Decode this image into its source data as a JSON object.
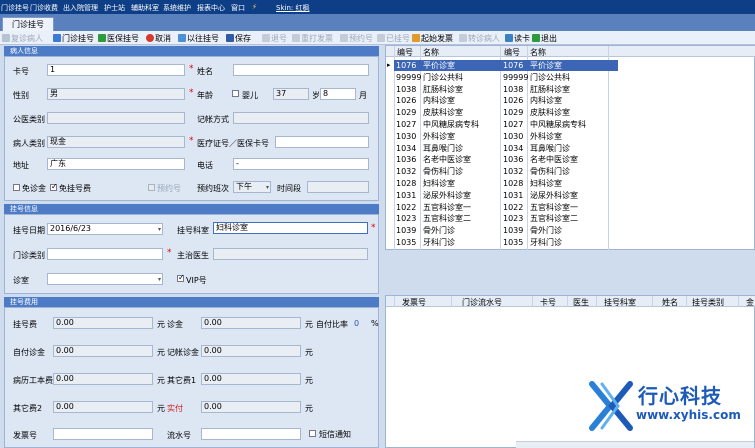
{
  "menu": [
    "门诊挂号",
    "门诊收费",
    "出入院管理",
    "护士站",
    "辅助科室",
    "系统维护",
    "报表中心",
    "窗口",
    "Skin: 红枫"
  ],
  "tab_label": "门诊挂号",
  "toolbar": {
    "items": [
      {
        "label": "复诊病人",
        "enabled": false
      },
      {
        "label": "门诊挂号",
        "enabled": true
      },
      {
        "label": "医保挂号",
        "enabled": true
      },
      {
        "label": "取消",
        "enabled": true
      },
      {
        "label": "以往挂号",
        "enabled": true
      },
      {
        "label": "保存",
        "enabled": true
      },
      {
        "label": "退号",
        "enabled": false
      },
      {
        "label": "重打发票",
        "enabled": false
      },
      {
        "label": "预约号",
        "enabled": false
      },
      {
        "label": "已挂号",
        "enabled": false
      },
      {
        "label": "起始发票",
        "enabled": true
      },
      {
        "label": "转诊病人",
        "enabled": false
      },
      {
        "label": "读卡",
        "enabled": true
      },
      {
        "label": "退出",
        "enabled": true
      }
    ]
  },
  "patient": {
    "section": "病人信息",
    "card_label": "卡号",
    "card_value": "1",
    "name_label": "姓名",
    "name_value": "",
    "gender_label": "性别",
    "gender_value": "男",
    "age_label": "年龄",
    "infant_label": "婴儿",
    "age_years": "37",
    "year_unit": "岁",
    "age_months": "8",
    "month_unit": "月",
    "insurance_label": "公医类别",
    "account_label": "记帐方式",
    "ptype_label": "病人类别",
    "ptype_value": "现金",
    "cert_label": "医疗证号／医保卡号",
    "addr_label": "地址",
    "addr_value": "广东",
    "phone_label": "电话",
    "phone_value": "-",
    "free_fee_label": "免诊金",
    "free_reg_label": "免挂号费",
    "reserve_label": "预约号",
    "reserve_time_label": "预约班次",
    "reserve_time_value": "下午",
    "time_label": "时间段"
  },
  "registration": {
    "section": "挂号信息",
    "date_label": "挂号日期",
    "date_value": "2016/6/23",
    "dept_label": "挂号科室",
    "dept_value": "妇科诊室",
    "clinic_type_label": "门诊类别",
    "doctor_label": "主治医生",
    "room_label": "诊室",
    "vip_label": "VIP号"
  },
  "fees": {
    "section": "挂号费用",
    "reg_fee_label": "挂号费",
    "reg_fee": "0.00",
    "consult_label": "诊金",
    "consult_fee": "0.00",
    "self_ratio_label": "自付比率",
    "self_ratio": "0",
    "pct": "%",
    "self_consult_label": "自付诊金",
    "self_consult": "0.00",
    "acct_consult_label": "记帐诊金",
    "acct_consult": "0.00",
    "record_label": "病历工本费",
    "record_fee": "0.00",
    "other1_label": "其它费1",
    "other1": "0.00",
    "other2_label": "其它费2",
    "other2": "0.00",
    "paid_label": "实付",
    "paid": "0.00",
    "yuan": "元",
    "invoice_label": "发票号",
    "serial_label": "流水号",
    "sms_label": "短信通知"
  },
  "dept_grid": {
    "headers": [
      "编号",
      "名称",
      "编号",
      "名称"
    ],
    "rows": [
      [
        "1076",
        "平价诊室"
      ],
      [
        "99999",
        "门诊公共科"
      ],
      [
        "1038",
        "肛肠科诊室"
      ],
      [
        "1026",
        "内科诊室"
      ],
      [
        "1029",
        "皮肤科诊室"
      ],
      [
        "1027",
        "中风糖尿病专科"
      ],
      [
        "1030",
        "外科诊室"
      ],
      [
        "1034",
        "耳鼻喉门诊"
      ],
      [
        "1036",
        "名老中医诊室"
      ],
      [
        "1032",
        "骨伤科门诊"
      ],
      [
        "1028",
        "妇科诊室"
      ],
      [
        "1031",
        "泌尿外科诊室"
      ],
      [
        "1022",
        "五官科诊室一"
      ],
      [
        "1023",
        "五官科诊室二"
      ],
      [
        "1039",
        "骨外门诊"
      ],
      [
        "1035",
        "牙科门诊"
      ]
    ]
  },
  "history_grid": {
    "headers": [
      "发票号",
      "门诊流水号",
      "卡号",
      "医生",
      "挂号科室",
      "姓名",
      "挂号类别",
      "金"
    ]
  },
  "logo": {
    "brand": "行心科技",
    "url": "www.xyhis.com"
  },
  "colors": {
    "menubar": "#0e3f86",
    "section_header": "#4d7bc6",
    "selected_row": "#3c65b5",
    "brand": "#1e5bb8"
  }
}
